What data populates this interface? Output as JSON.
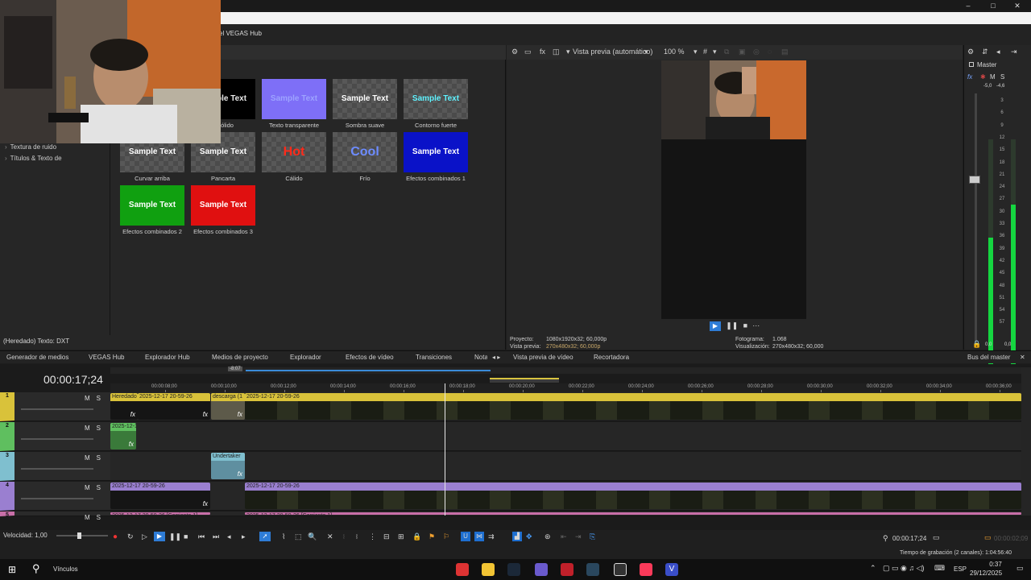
{
  "window": {
    "hub_title": "el VEGAS Hub",
    "min_label": "–",
    "max_label": "□",
    "close_label": "✕"
  },
  "presets": [
    {
      "label": "o sólido",
      "sample": "Sample Text",
      "fg": "#e9e9e9",
      "bg": "#000000"
    },
    {
      "label": "Texto transparente",
      "sample": "Sample Text",
      "fg": "#9da3ff",
      "bg": "#7e6ff7"
    },
    {
      "label": "Sombra suave",
      "sample": "Sample Text",
      "fg": "#ffffff",
      "bg": ""
    },
    {
      "label": "Contorno fuerte",
      "sample": "Sample Text",
      "fg": "#5ff2ff",
      "bg": ""
    },
    {
      "label": "Curvar arriba",
      "sample": "Sample Text",
      "fg": "#ffffff",
      "bg": ""
    },
    {
      "label": "Pancarta",
      "sample": "Sample Text",
      "fg": "#ffffff",
      "bg": ""
    },
    {
      "label": "Cálido",
      "sample": "Hot",
      "fg": "#ff2a1a",
      "bg": ""
    },
    {
      "label": "Frío",
      "sample": "Cool",
      "fg": "#6d8cff",
      "bg": ""
    },
    {
      "label": "Efectos combinados 1",
      "sample": "Sample Text",
      "fg": "#ffffff",
      "bg": "#0a12c8"
    },
    {
      "label": "Efectos combinados 2",
      "sample": "Sample Text",
      "fg": "#ffffff",
      "bg": "#10a010"
    },
    {
      "label": "Efectos combinados 3",
      "sample": "Sample Text",
      "fg": "#ffffff",
      "bg": "#e01010"
    }
  ],
  "tree": [
    {
      "label": "Textura de ruido"
    },
    {
      "label": "Títulos & Texto de"
    }
  ],
  "status_left": "(Heredado) Texto: DXT",
  "preview": {
    "mode": "Vista previa (automático)",
    "zoom": "100 %",
    "project_label": "Proyecto:",
    "project_value": "1080x1920x32; 60,000p",
    "preview_label": "Vista previa:",
    "preview_value": "270x480x32; 60,000p",
    "frame_label": "Fotograma:",
    "frame_value": "1.068",
    "display_label": "Visualización:",
    "display_value": "270x480x32; 60,000"
  },
  "master": {
    "title": "Master",
    "fx": "fx",
    "m": "M",
    "s": "S",
    "top_left": "-5,0",
    "top_right": "-4,6",
    "bottom_left": "0,0",
    "bottom_right": "0,0",
    "scale": [
      "3",
      "6",
      "9",
      "12",
      "15",
      "18",
      "21",
      "24",
      "27",
      "30",
      "33",
      "36",
      "39",
      "42",
      "45",
      "48",
      "51",
      "54",
      "57"
    ],
    "level_left": 0.61,
    "level_right": 0.74
  },
  "tabs": [
    {
      "label": "Generador de medios"
    },
    {
      "label": "VEGAS Hub"
    },
    {
      "label": "Explorador Hub"
    },
    {
      "label": "Medios de proyecto"
    },
    {
      "label": "Explorador"
    },
    {
      "label": "Efectos de vídeo"
    },
    {
      "label": "Transiciones"
    },
    {
      "label": "Nota"
    },
    {
      "label": "Vista previa de vídeo"
    },
    {
      "label": "Recortadora"
    },
    {
      "label": "Bus del master"
    }
  ],
  "timeline": {
    "current_time": "00:00:17;24",
    "loop_marker": "-8:07",
    "ruler": [
      "00:00:08;00",
      "00:00:10;00",
      "00:00:12;00",
      "00:00:14;00",
      "00:00:16;00",
      "00:00:18;00",
      "00:00:20;00",
      "00:00:22;00",
      "00:00:24;00",
      "00:00:26;00",
      "00:00:28;00",
      "00:00:30;00",
      "00:00:32;00",
      "00:00:34;00",
      "00:00:36;00"
    ],
    "tracks": [
      {
        "num": "1",
        "m": "M",
        "s": "S",
        "color": "#d9c23a"
      },
      {
        "num": "2",
        "m": "M",
        "s": "S",
        "color": "#5fbf5f"
      },
      {
        "num": "3",
        "m": "M",
        "s": "S",
        "color": "#7fbfcf"
      },
      {
        "num": "4",
        "m": "M",
        "s": "S",
        "color": "#9a7fd0"
      },
      {
        "num": "5",
        "m": "M",
        "s": "S",
        "color": "#c86fa8"
      }
    ],
    "clips": {
      "t1a": "Heredado",
      "t1b": "2025-12-17 20-59-26",
      "t1c": "descarga (1",
      "t1d": "2025-12-17 20-59-26",
      "t2a": "2025-12-1",
      "t3a": "Undertaker",
      "t4a": "2025-12-17 20-59-26",
      "t4b": "2025-12-17 20-59-26",
      "t5a": "2025-12-17 20-59-26 [Corriente 1]",
      "t5b": "2025-12-17 20-59-26 [Corriente 1]"
    },
    "fx_label": "fx",
    "speed": "Velocidad: 1,00",
    "cursor_time": "00:00:17;24",
    "end_time": "00:00:02;09",
    "record_time": "Tiempo de grabación (2 canales): 1:04:56:40",
    "vol_left": "-4,6"
  },
  "taskbar": {
    "search_label": "Vínculos",
    "lang": "ESP",
    "time": "0:37",
    "date": "29/12/2025"
  }
}
